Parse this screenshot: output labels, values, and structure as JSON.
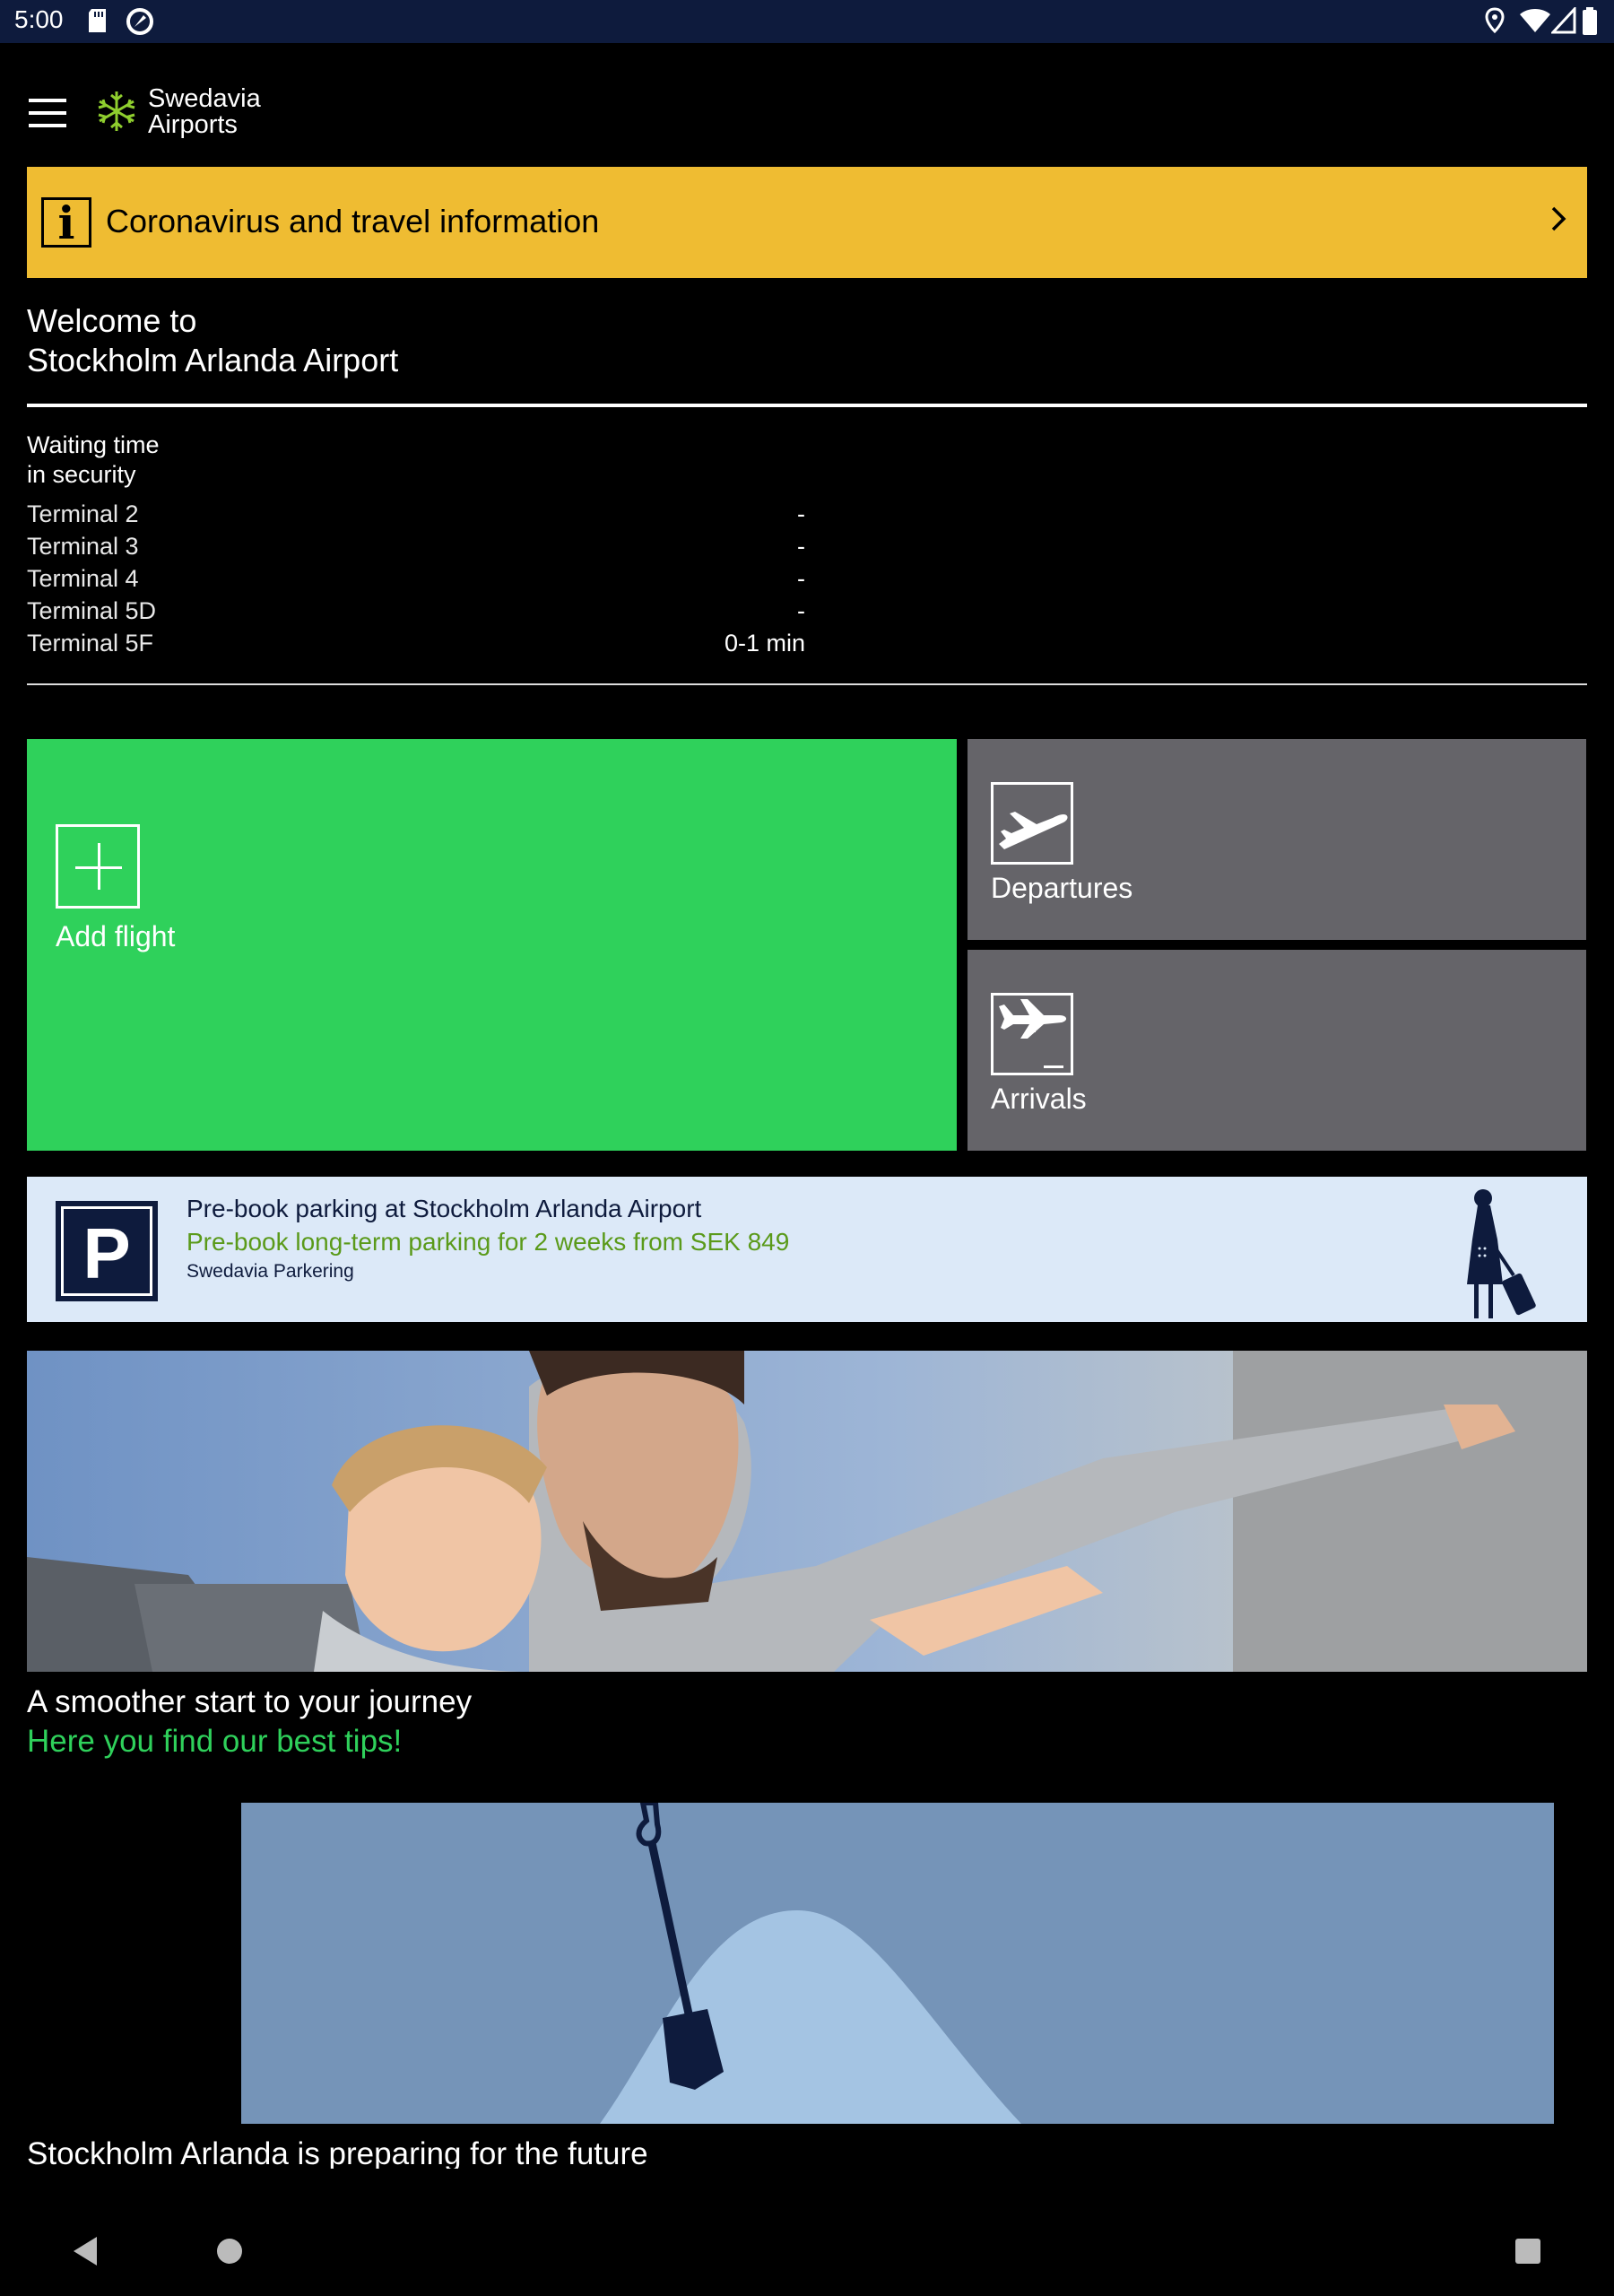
{
  "status_bar": {
    "time": "5:00",
    "icons": [
      "sd-card-icon",
      "at-sync-icon",
      "location-icon",
      "wifi-icon",
      "signal-icon",
      "battery-icon"
    ]
  },
  "header": {
    "logo_line1": "Swedavia",
    "logo_line2": "Airports",
    "menu_icon": "hamburger-menu-icon"
  },
  "info_banner": {
    "text": "Coronavirus and travel information",
    "icon": "info-icon",
    "bg_color": "#efbc32"
  },
  "welcome": {
    "line1": "Welcome to",
    "line2": "Stockholm Arlanda Airport"
  },
  "waiting": {
    "title_line1": "Waiting time",
    "title_line2": "in security",
    "rows": [
      {
        "terminal": "Terminal 2",
        "time": "-"
      },
      {
        "terminal": "Terminal 3",
        "time": "-"
      },
      {
        "terminal": "Terminal 4",
        "time": "-"
      },
      {
        "terminal": "Terminal 5D",
        "time": "-"
      },
      {
        "terminal": "Terminal 5F",
        "time": "0-1 min"
      }
    ]
  },
  "tiles": {
    "add_flight": "Add flight",
    "departures": "Departures",
    "arrivals": "Arrivals",
    "add_color": "#2fd15b",
    "gray_color": "#656469"
  },
  "parking": {
    "title": "Pre-book parking at Stockholm Arlanda Airport",
    "subtitle": "Pre-book long-term parking for 2 weeks from SEK 849",
    "source": "Swedavia Parkering",
    "icon_letter": "P"
  },
  "tips": {
    "title": "A smoother start to your journey",
    "subtitle": "Here you find our best tips!"
  },
  "future": {
    "title": "Stockholm Arlanda is preparing for the future"
  },
  "nav": {
    "icons": [
      "back-icon",
      "home-icon",
      "recents-icon"
    ]
  }
}
